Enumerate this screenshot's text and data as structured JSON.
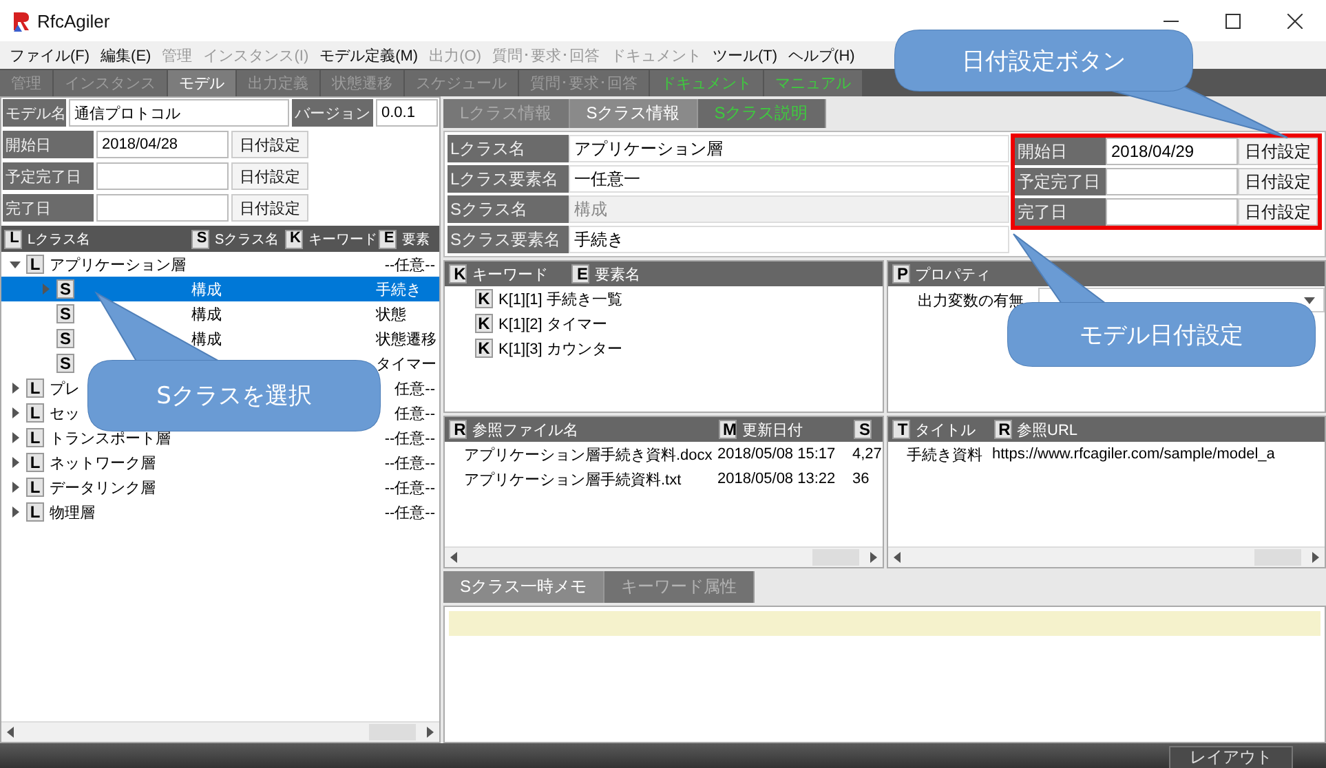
{
  "window": {
    "title": "RfcAgiler"
  },
  "menu": [
    {
      "label": "ファイル(F)",
      "disabled": false
    },
    {
      "label": "編集(E)",
      "disabled": false
    },
    {
      "label": "管理",
      "disabled": true
    },
    {
      "label": "インスタンス(I)",
      "disabled": true
    },
    {
      "label": "モデル定義(M)",
      "disabled": false
    },
    {
      "label": "出力(O)",
      "disabled": true
    },
    {
      "label": "質問･要求･回答",
      "disabled": true
    },
    {
      "label": "ドキュメント",
      "disabled": true
    },
    {
      "label": "ツール(T)",
      "disabled": false
    },
    {
      "label": "ヘルプ(H)",
      "disabled": false
    }
  ],
  "main_tabs": [
    {
      "label": "管理",
      "selected": false,
      "kind": "normal"
    },
    {
      "label": "インスタンス",
      "selected": false,
      "kind": "normal"
    },
    {
      "label": "モデル",
      "selected": true,
      "kind": "normal"
    },
    {
      "label": "出力定義",
      "selected": false,
      "kind": "normal"
    },
    {
      "label": "状態遷移",
      "selected": false,
      "kind": "normal"
    },
    {
      "label": "スケジュール",
      "selected": false,
      "kind": "normal"
    },
    {
      "label": "質問･要求･回答",
      "selected": false,
      "kind": "normal"
    },
    {
      "label": "ドキュメント",
      "selected": false,
      "kind": "link"
    },
    {
      "label": "マニュアル",
      "selected": false,
      "kind": "link"
    }
  ],
  "model": {
    "name_label": "モデル名",
    "name": "通信プロトコル",
    "version_label": "バージョン",
    "version": "0.0.1"
  },
  "model_dates": [
    {
      "label": "開始日",
      "value": "2018/04/28",
      "button": "日付設定"
    },
    {
      "label": "予定完了日",
      "button": "日付設定"
    },
    {
      "label": "完了日",
      "button": "日付設定"
    }
  ],
  "tree": {
    "columns": [
      {
        "icon": "L",
        "label": "Lクラス名"
      },
      {
        "icon": "S",
        "label": "Sクラス名"
      },
      {
        "icon": "K",
        "label": "キーワード"
      },
      {
        "icon": "E",
        "label": "要素"
      }
    ],
    "items": [
      {
        "badge": "L",
        "name": "アプリケーション層",
        "element": "--任意--",
        "expanded": true,
        "selected": false,
        "children": [
          {
            "badge": "S",
            "sclass": "構成",
            "element": "手続き",
            "selected": true
          },
          {
            "badge": "S",
            "sclass": "構成",
            "element": "状態",
            "selected": false
          },
          {
            "badge": "S",
            "sclass": "構成",
            "element": "状態遷移",
            "selected": false
          },
          {
            "badge": "S",
            "element": "タイマー",
            "selected": false
          }
        ]
      },
      {
        "badge": "L",
        "name": "プレ",
        "element": "任意--",
        "expanded": false,
        "selected": false
      },
      {
        "badge": "L",
        "name": "セッ",
        "element": "任意--",
        "expanded": false,
        "selected": false
      },
      {
        "badge": "L",
        "name": "トランスポート層",
        "element": "--任意--",
        "expanded": false,
        "selected": false
      },
      {
        "badge": "L",
        "name": "ネットワーク層",
        "element": "--任意--",
        "expanded": false,
        "selected": false
      },
      {
        "badge": "L",
        "name": "データリンク層",
        "element": "--任意--",
        "expanded": false,
        "selected": false
      },
      {
        "badge": "L",
        "name": "物理層",
        "element": "--任意--",
        "expanded": false,
        "selected": false
      }
    ]
  },
  "sub_tabs": [
    {
      "label": "Lクラス情報",
      "selected": false,
      "kind": "normal"
    },
    {
      "label": "Sクラス情報",
      "selected": true,
      "kind": "normal"
    },
    {
      "label": "Sクラス説明",
      "selected": false,
      "kind": "link"
    }
  ],
  "sclass_form": [
    {
      "label": "Lクラス名",
      "value": "アプリケーション層",
      "disabled": false
    },
    {
      "label": "Lクラス要素名",
      "value": "一任意一",
      "disabled": false
    },
    {
      "label": "Sクラス名",
      "value": "構成",
      "disabled": true
    },
    {
      "label": "Sクラス要素名",
      "value": "手続き",
      "disabled": false
    }
  ],
  "dates_panel": {
    "highlighted": true,
    "rows": [
      {
        "label": "開始日",
        "value": "2018/04/29",
        "button": "日付設定"
      },
      {
        "label": "予定完了日",
        "button": "日付設定"
      },
      {
        "label": "完了日",
        "button": "日付設定"
      }
    ]
  },
  "keywords": {
    "columns": [
      {
        "icon": "K",
        "label": "キーワード"
      },
      {
        "icon": "E",
        "label": "要素名"
      }
    ],
    "rows": [
      {
        "icon": "K",
        "text": "K[1][1] 手続き一覧"
      },
      {
        "icon": "K",
        "text": "K[1][2] タイマー"
      },
      {
        "icon": "K",
        "text": "K[1][3] カウンター"
      }
    ]
  },
  "properties": {
    "columns": [
      {
        "icon": "P",
        "label": "プロパティ"
      }
    ],
    "rows": [
      {
        "name": "出力変数の有無"
      }
    ]
  },
  "files": {
    "columns": [
      {
        "icon": "R",
        "label": "参照ファイル名"
      },
      {
        "icon": "M",
        "label": "更新日付"
      },
      {
        "icon": "S"
      }
    ],
    "rows": [
      {
        "name": "アプリケーション層手続き資料.docx",
        "date": "2018/05/08 15:17",
        "size": "4,27"
      },
      {
        "name": "アプリケーション層手続資料.txt",
        "date": "2018/05/08 13:22",
        "size": "36"
      }
    ]
  },
  "links": {
    "columns": [
      {
        "icon": "T",
        "label": "タイトル"
      },
      {
        "icon": "R",
        "label": "参照URL"
      }
    ],
    "rows": [
      {
        "title": "手続き資料",
        "url": "https://www.rfcagiler.com/sample/model_a"
      }
    ]
  },
  "memo_tabs": [
    {
      "label": "Sクラス一時メモ",
      "selected": true
    },
    {
      "label": "キーワード属性",
      "selected": false
    }
  ],
  "status_bar": {
    "button": "レイアウト"
  },
  "callouts": [
    {
      "text": "日付設定ボタン"
    },
    {
      "text": "Sクラスを選択"
    },
    {
      "text": "モデル日付設定"
    }
  ]
}
